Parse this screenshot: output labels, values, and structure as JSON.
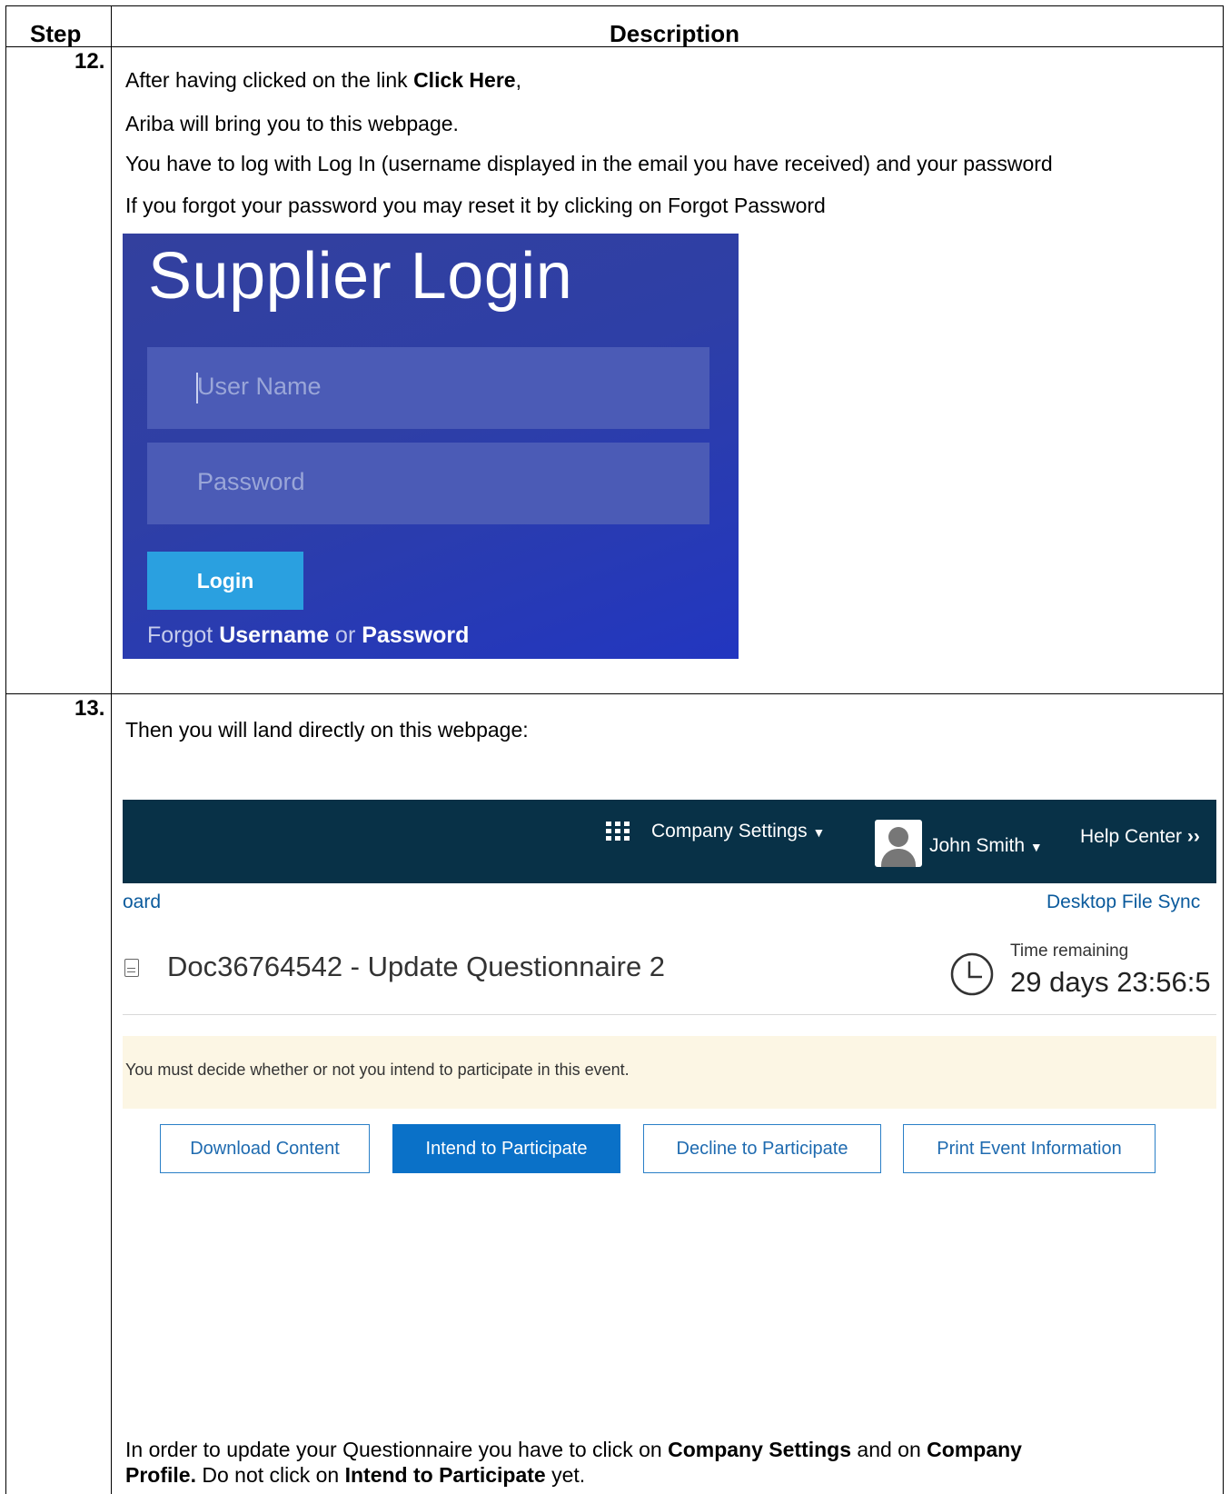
{
  "table": {
    "col_step": "Step",
    "col_description": "Description"
  },
  "step12": {
    "number": "12.",
    "line1_before": "After having clicked on the link ",
    "line1_bold": "Click Here",
    "line1_after": ",",
    "line2": "Ariba will bring you to this webpage.",
    "line3": "You have to log with Log In (username displayed in the email you have received) and your password",
    "line4": "If you forgot your password you may reset it by clicking on Forgot Password",
    "login": {
      "title": "Supplier Login",
      "username_placeholder": "User Name",
      "password_placeholder": "Password",
      "login_button": "Login",
      "forgot_prefix": "Forgot ",
      "forgot_username": "Username",
      "forgot_or": " or ",
      "forgot_password": "Password"
    }
  },
  "step13": {
    "number": "13.",
    "intro": "Then you will land directly on this webpage:",
    "ariba": {
      "company_settings": "Company Settings",
      "user_name": "John Smith",
      "help_center": "Help Center",
      "breadcrumb": "oard",
      "desktop_sync": "Desktop File Sync",
      "doc_title": "Doc36764542 - Update Questionnaire 2",
      "time_label": "Time remaining",
      "time_value": "29 days 23:56:5",
      "notice": "You must decide whether or not you intend to participate in this event.",
      "buttons": {
        "download": "Download Content",
        "intend": "Intend to Participate",
        "decline": "Decline to Participate",
        "print": "Print Event Information"
      },
      "colors": {
        "topbar": "#083147",
        "primary": "#0a71c8",
        "notice_bg": "#fcf6e4"
      }
    },
    "closing": {
      "p1": "In order to update your Questionnaire you have to click on ",
      "b1": "Company Settings",
      "p2": " and on ",
      "b2": "Company",
      "b3": "Profile.",
      "p3": " Do not click on ",
      "b4": "Intend to Participate",
      "p4": " yet."
    }
  }
}
